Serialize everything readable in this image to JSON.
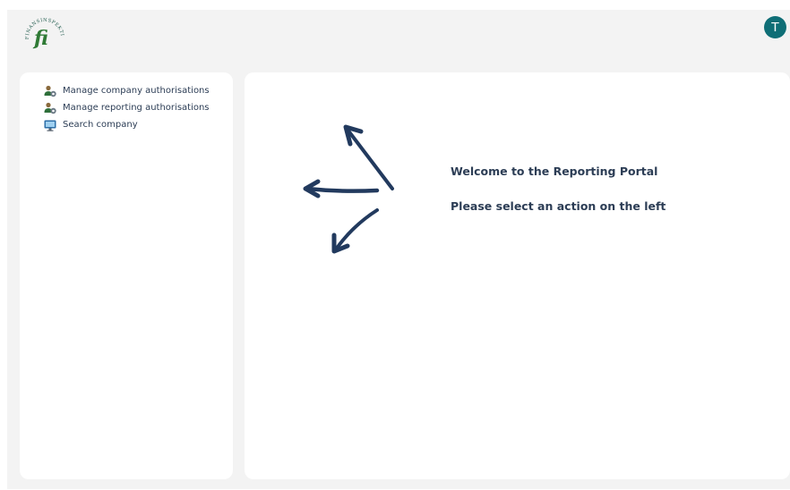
{
  "header": {
    "logo_text": "FINANSINSPEKTIONEN",
    "logo_letters": "fi",
    "avatar_initial": "T"
  },
  "sidebar": {
    "items": [
      {
        "label": "Manage company authorisations",
        "icon": "users-gear-icon"
      },
      {
        "label": "Manage reporting authorisations",
        "icon": "users-gear-icon"
      },
      {
        "label": "Search company",
        "icon": "monitor-search-icon"
      }
    ]
  },
  "main": {
    "welcome_title": "Welcome to the Reporting Portal",
    "instruction": "Please select an action on the left",
    "arrow_color": "#223a5e"
  },
  "colors": {
    "page_background": "#f3f3f3",
    "panel_background": "#ffffff",
    "avatar": "#0f6e76",
    "text": "#2c3d55"
  }
}
